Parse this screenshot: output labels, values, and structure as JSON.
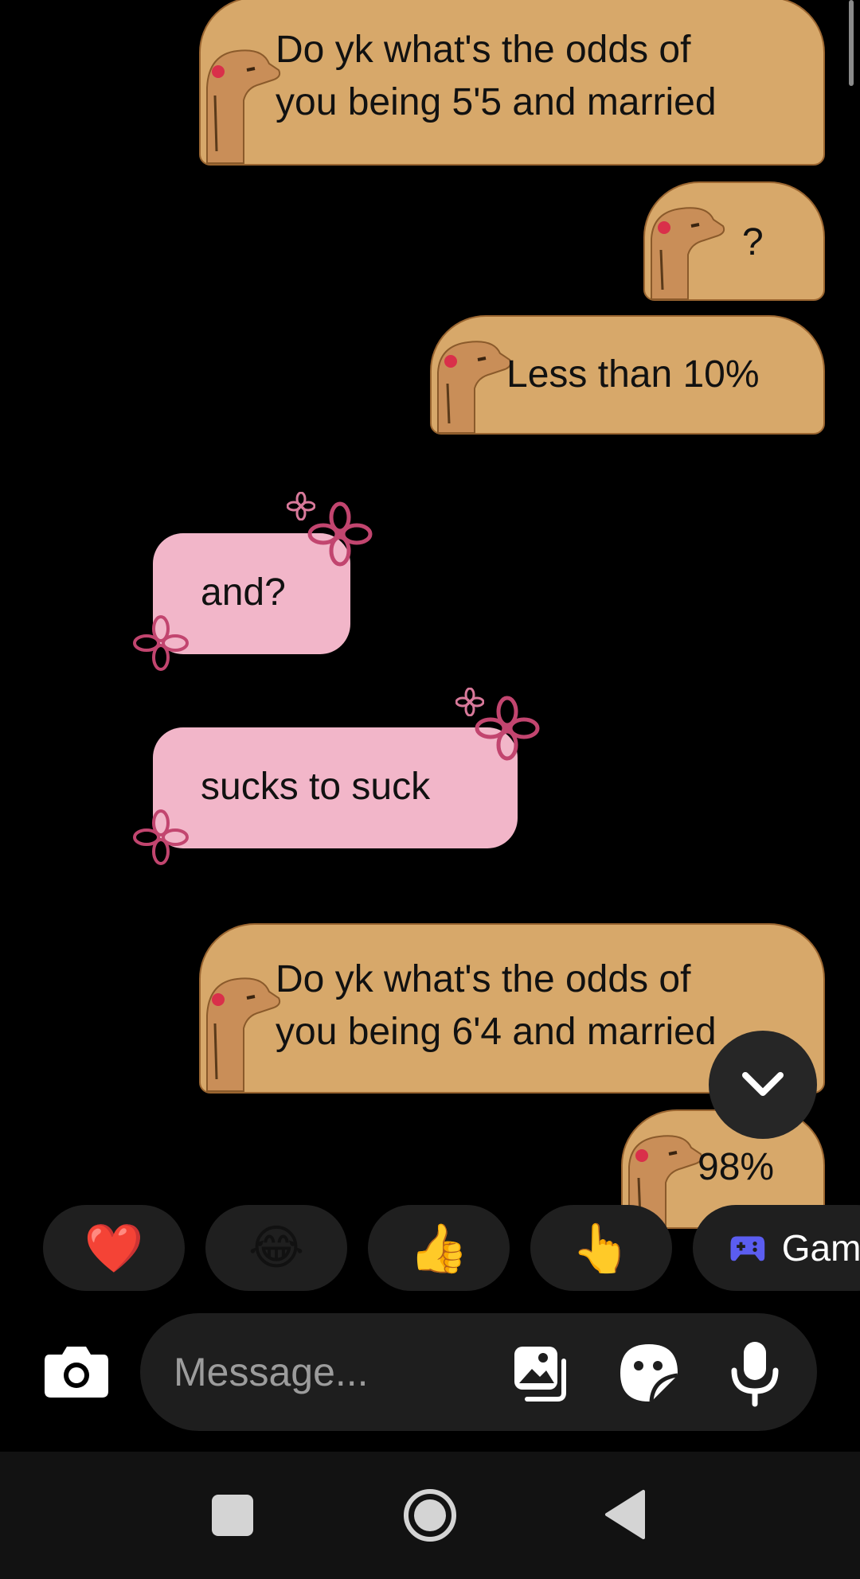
{
  "messages": [
    {
      "side": "right",
      "style": "capybara",
      "text": "Do yk what's the odds of\nyou being 5'5 and married"
    },
    {
      "side": "right",
      "style": "capybara",
      "text": "?"
    },
    {
      "side": "right",
      "style": "capybara",
      "text": "Less than 10%"
    },
    {
      "side": "left",
      "style": "flower",
      "text": "and?"
    },
    {
      "side": "left",
      "style": "flower",
      "text": "sucks to suck"
    },
    {
      "side": "right",
      "style": "capybara",
      "text": "Do yk what's the odds of\nyou being 6'4 and married"
    },
    {
      "side": "right",
      "style": "capybara",
      "text": "98%"
    }
  ],
  "scroll_down_button": {
    "icon": "chevron-down-icon"
  },
  "quick_reactions": [
    {
      "emoji": "❤️",
      "name": "heart"
    },
    {
      "emoji": "😂",
      "name": "laughing"
    },
    {
      "emoji": "👍",
      "name": "thumbs-up"
    },
    {
      "emoji": "👆",
      "name": "pointing"
    }
  ],
  "games_chip": {
    "icon": "gamepad-icon",
    "label": "Games"
  },
  "composer": {
    "placeholder": "Message...",
    "camera_icon": "camera-icon",
    "gallery_icon": "gallery-icon",
    "sticker_icon": "sticker-icon",
    "mic_icon": "microphone-icon"
  },
  "nav": {
    "recents_icon": "square-icon",
    "home_icon": "home-circle-icon",
    "back_icon": "back-triangle-icon"
  },
  "colors": {
    "background": "#000000",
    "capybara_bubble": "#d7a86a",
    "capybara_outline": "#9a6530",
    "pink_bubble": "#f2b6c9",
    "flower": "#c2456f",
    "chip": "#1f1f1f",
    "composer": "#1e1e1e",
    "navbar": "#121212"
  }
}
